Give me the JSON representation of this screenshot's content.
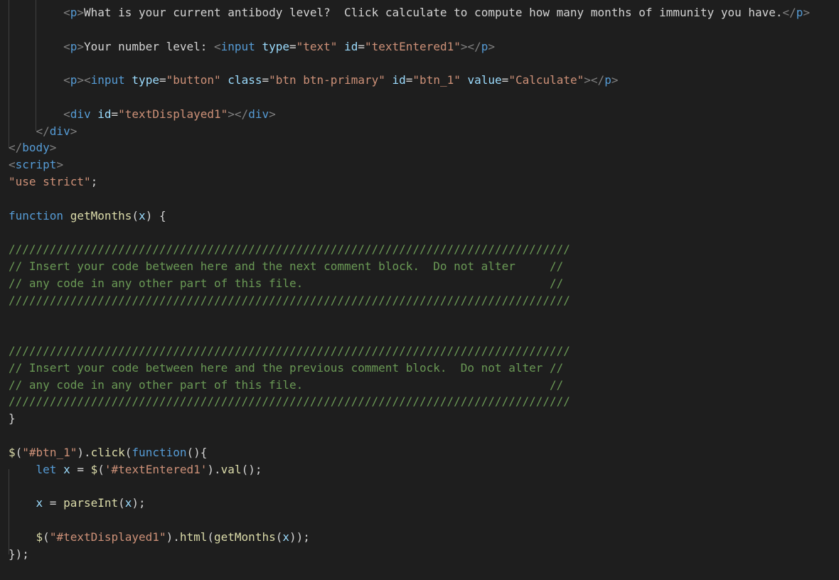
{
  "editor": {
    "theme_colors": {
      "background": "#1e1e1e",
      "tag": "#569cd6",
      "bracket": "#808080",
      "attribute": "#9cdcfe",
      "string": "#ce9178",
      "keyword": "#569cd6",
      "function": "#dcdcaa",
      "variable": "#9cdcfe",
      "comment": "#6a9955",
      "text": "#d4d4d4"
    },
    "lines": [
      [
        [
          "        ",
          "plain"
        ],
        [
          "<",
          "punct"
        ],
        [
          "p",
          "tag"
        ],
        [
          ">",
          "punct"
        ],
        [
          "What is your current antibody level?  Click calculate to compute how many months of immunity you have.",
          "plain"
        ],
        [
          "</",
          "punct"
        ],
        [
          "p",
          "tag"
        ],
        [
          ">",
          "punct"
        ]
      ],
      [],
      [
        [
          "        ",
          "plain"
        ],
        [
          "<",
          "punct"
        ],
        [
          "p",
          "tag"
        ],
        [
          ">",
          "punct"
        ],
        [
          "Your number level: ",
          "plain"
        ],
        [
          "<",
          "punct"
        ],
        [
          "input",
          "tag"
        ],
        [
          " ",
          "plain"
        ],
        [
          "type",
          "attr"
        ],
        [
          "=",
          "plain"
        ],
        [
          "\"text\"",
          "str"
        ],
        [
          " ",
          "plain"
        ],
        [
          "id",
          "attr"
        ],
        [
          "=",
          "plain"
        ],
        [
          "\"textEntered1\"",
          "str"
        ],
        [
          ">",
          "punct"
        ],
        [
          "</",
          "punct"
        ],
        [
          "p",
          "tag"
        ],
        [
          ">",
          "punct"
        ]
      ],
      [],
      [
        [
          "        ",
          "plain"
        ],
        [
          "<",
          "punct"
        ],
        [
          "p",
          "tag"
        ],
        [
          "><",
          "punct"
        ],
        [
          "input",
          "tag"
        ],
        [
          " ",
          "plain"
        ],
        [
          "type",
          "attr"
        ],
        [
          "=",
          "plain"
        ],
        [
          "\"button\"",
          "str"
        ],
        [
          " ",
          "plain"
        ],
        [
          "class",
          "attr"
        ],
        [
          "=",
          "plain"
        ],
        [
          "\"btn btn-primary\"",
          "str"
        ],
        [
          " ",
          "plain"
        ],
        [
          "id",
          "attr"
        ],
        [
          "=",
          "plain"
        ],
        [
          "\"btn_1\"",
          "str"
        ],
        [
          " ",
          "plain"
        ],
        [
          "value",
          "attr"
        ],
        [
          "=",
          "plain"
        ],
        [
          "\"Calculate\"",
          "str"
        ],
        [
          "></",
          "punct"
        ],
        [
          "p",
          "tag"
        ],
        [
          ">",
          "punct"
        ]
      ],
      [],
      [
        [
          "        ",
          "plain"
        ],
        [
          "<",
          "punct"
        ],
        [
          "div",
          "tag"
        ],
        [
          " ",
          "plain"
        ],
        [
          "id",
          "attr"
        ],
        [
          "=",
          "plain"
        ],
        [
          "\"textDisplayed1\"",
          "str"
        ],
        [
          "></",
          "punct"
        ],
        [
          "div",
          "tag"
        ],
        [
          ">",
          "punct"
        ]
      ],
      [
        [
          "    ",
          "plain"
        ],
        [
          "</",
          "punct"
        ],
        [
          "div",
          "tag"
        ],
        [
          ">",
          "punct"
        ]
      ],
      [
        [
          "</",
          "punct"
        ],
        [
          "body",
          "tag"
        ],
        [
          ">",
          "punct"
        ]
      ],
      [
        [
          "<",
          "punct"
        ],
        [
          "script",
          "tag"
        ],
        [
          ">",
          "punct"
        ]
      ],
      [
        [
          "\"use strict\"",
          "str"
        ],
        [
          ";",
          "plain"
        ]
      ],
      [],
      [
        [
          "function",
          "kw"
        ],
        [
          " ",
          "plain"
        ],
        [
          "getMonths",
          "fn"
        ],
        [
          "(",
          "plain"
        ],
        [
          "x",
          "var"
        ],
        [
          ") {",
          "plain"
        ]
      ],
      [],
      [
        [
          "//////////////////////////////////////////////////////////////////////////////////",
          "cmt"
        ]
      ],
      [
        [
          "// Insert your code between here and the next comment block.  Do not alter     //",
          "cmt"
        ]
      ],
      [
        [
          "// any code in any other part of this file.                                    //",
          "cmt"
        ]
      ],
      [
        [
          "//////////////////////////////////////////////////////////////////////////////////",
          "cmt"
        ]
      ],
      [],
      [],
      [
        [
          "//////////////////////////////////////////////////////////////////////////////////",
          "cmt"
        ]
      ],
      [
        [
          "// Insert your code between here and the previous comment block.  Do not alter //",
          "cmt"
        ]
      ],
      [
        [
          "// any code in any other part of this file.                                    //",
          "cmt"
        ]
      ],
      [
        [
          "//////////////////////////////////////////////////////////////////////////////////",
          "cmt"
        ]
      ],
      [
        [
          "}",
          "plain"
        ]
      ],
      [],
      [
        [
          "$",
          "fn"
        ],
        [
          "(",
          "plain"
        ],
        [
          "\"#btn_1\"",
          "str"
        ],
        [
          ").",
          "plain"
        ],
        [
          "click",
          "fn"
        ],
        [
          "(",
          "plain"
        ],
        [
          "function",
          "kw"
        ],
        [
          "(){",
          "plain"
        ]
      ],
      [
        [
          "    ",
          "plain"
        ],
        [
          "let",
          "kw"
        ],
        [
          " ",
          "plain"
        ],
        [
          "x",
          "var"
        ],
        [
          " = ",
          "plain"
        ],
        [
          "$",
          "fn"
        ],
        [
          "(",
          "plain"
        ],
        [
          "'#textEntered1'",
          "str"
        ],
        [
          ").",
          "plain"
        ],
        [
          "val",
          "fn"
        ],
        [
          "();",
          "plain"
        ]
      ],
      [],
      [
        [
          "    ",
          "plain"
        ],
        [
          "x",
          "var"
        ],
        [
          " = ",
          "plain"
        ],
        [
          "parseInt",
          "fn"
        ],
        [
          "(",
          "plain"
        ],
        [
          "x",
          "var"
        ],
        [
          ");",
          "plain"
        ]
      ],
      [],
      [
        [
          "    ",
          "plain"
        ],
        [
          "$",
          "fn"
        ],
        [
          "(",
          "plain"
        ],
        [
          "\"#textDisplayed1\"",
          "str"
        ],
        [
          ").",
          "plain"
        ],
        [
          "html",
          "fn"
        ],
        [
          "(",
          "plain"
        ],
        [
          "getMonths",
          "fn"
        ],
        [
          "(",
          "plain"
        ],
        [
          "x",
          "var"
        ],
        [
          "));",
          "plain"
        ]
      ],
      [
        [
          "});",
          "plain"
        ]
      ]
    ]
  }
}
